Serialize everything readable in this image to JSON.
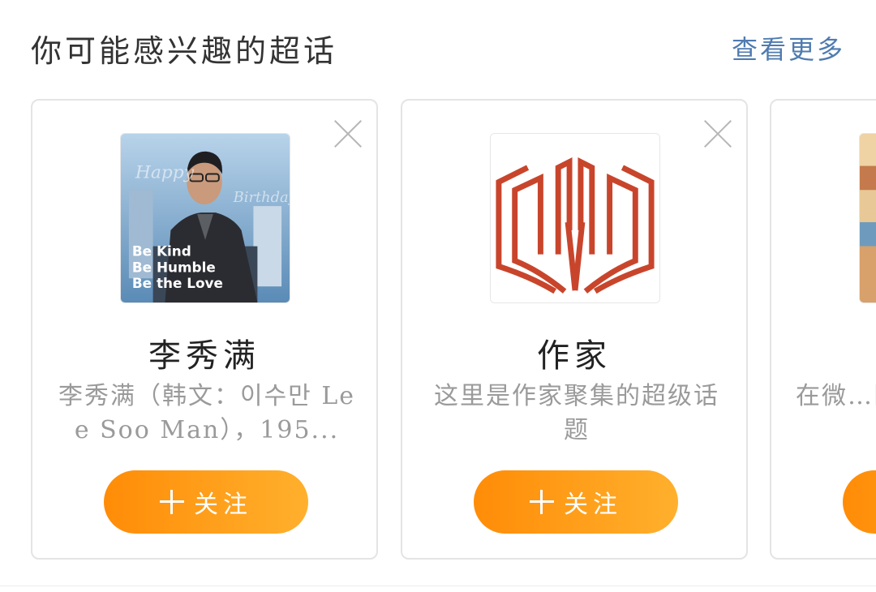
{
  "header": {
    "title": "你可能感兴趣的超话",
    "more_label": "查看更多"
  },
  "cards": [
    {
      "name": "李秀满",
      "description": "李秀满（韩文：이수만 Lee Soo Man），195...",
      "follow_label": "关注",
      "avatar_text": [
        "Happy",
        "Birthday!",
        "Be Kind",
        "Be Humble",
        "Be the Love"
      ]
    },
    {
      "name": "作家",
      "description": "这里是作家聚集的超级话题",
      "follow_label": "关注"
    },
    {
      "name": "",
      "description": "在微…区，…",
      "follow_label": ""
    }
  ],
  "colors": {
    "accent_link": "#4f7bb0",
    "follow_gradient_start": "#ff8c07",
    "follow_gradient_end": "#ffb02d",
    "logo_red": "#c8452c"
  }
}
